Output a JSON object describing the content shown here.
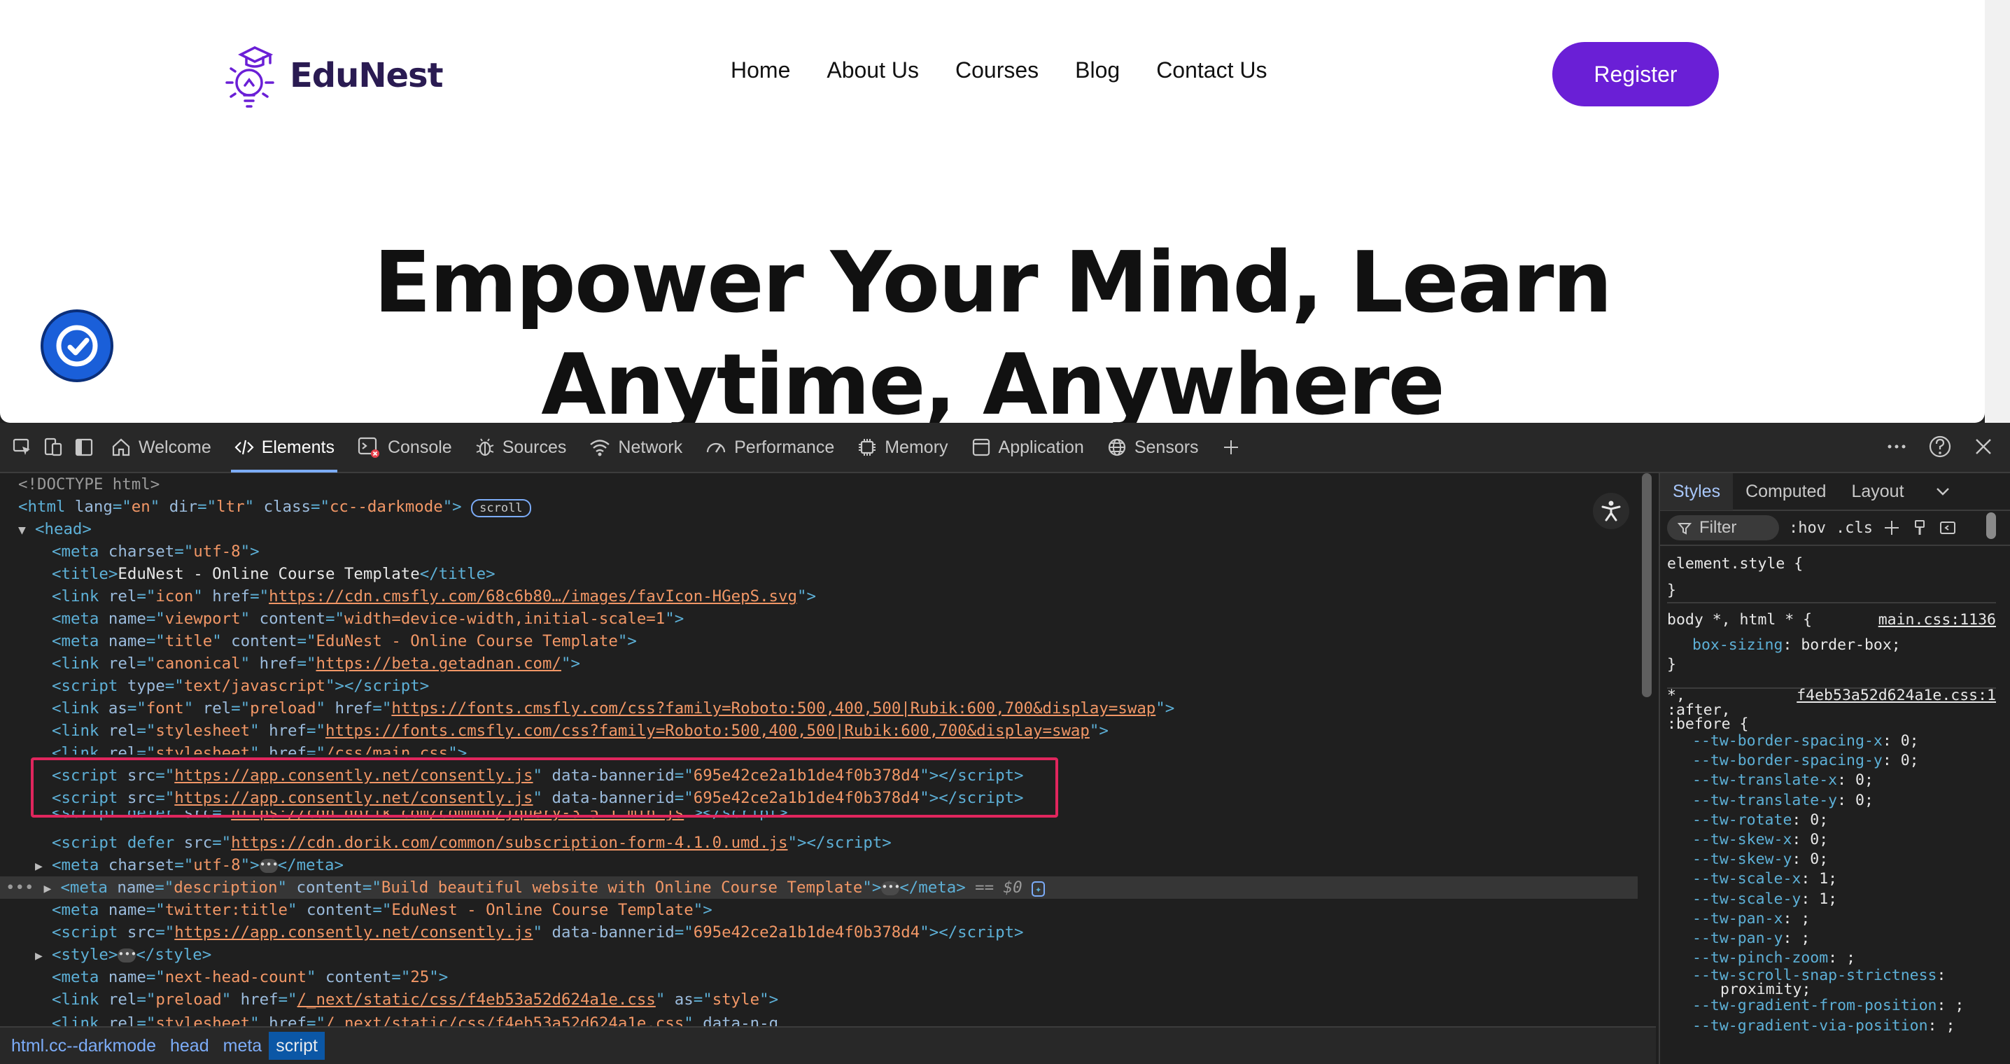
{
  "website": {
    "logo_text": "EduNest",
    "nav": [
      "Home",
      "About Us",
      "Courses",
      "Blog",
      "Contact Us"
    ],
    "register_label": "Register",
    "hero_line1": "Empower Your Mind, Learn",
    "hero_line2": "Anytime, Anywhere",
    "brand_color": "#6a1fd6"
  },
  "devtools": {
    "tabs": [
      "Welcome",
      "Elements",
      "Console",
      "Sources",
      "Network",
      "Performance",
      "Memory",
      "Application",
      "Sensors"
    ],
    "active_tab": "Elements",
    "dom": {
      "doctype": "<!DOCTYPE html>",
      "html_open": {
        "lang": "en",
        "dir": "ltr",
        "class": "cc--darkmode",
        "badge": "scroll"
      },
      "head": "head",
      "title_text": "EduNest - Online Course Template",
      "favicon_href": "https://cdn.cmsfly.com/68c6b80…/images/favIcon-HGepS.svg",
      "viewport_content": "width=device-width,initial-scale=1",
      "meta_title_content": "EduNest - Online Course Template",
      "canonical_href": "https://beta.getadnan.com/",
      "script_type": "text/javascript",
      "font_href": "https://fonts.cmsfly.com/css?family=Roboto:500,400,500|Rubik:600,700&display=swap",
      "stylesheet_href": "https://fonts.cmsfly.com/css?family=Roboto:500,400,500|Rubik:600,700&display=swap",
      "main_css_href": "/css/main.css",
      "consently_src": "https://app.consently.net/consently.js",
      "banner_id": "695e42ce2a1b1de4f0b378d4",
      "jquery_src": "https://cdn.dorik.com/common/jquery-3.5.1.min.js",
      "subscription_src": "https://cdn.dorik.com/common/subscription-form-4.1.0.umd.js",
      "meta_charset": "utf-8",
      "description_content": "Build beautiful website with Online Course Template",
      "dollar0": "== $0",
      "twitter_title_content": "EduNest - Online Course Template",
      "next_head_count": "25",
      "preload_href": "/_next/static/css/f4eb53a52d624a1e.css",
      "preload_as": "style",
      "stylesheet2_href": "/_next/static/css/f4eb53a52d624a1e.css",
      "data_n_g": "data-n-g"
    },
    "breadcrumbs": [
      "html.cc--darkmode",
      "head",
      "meta",
      "script"
    ],
    "active_breadcrumb": "script",
    "styles_tabs": [
      "Styles",
      "Computed",
      "Layout"
    ],
    "filter_placeholder": "Filter",
    "hov": ":hov",
    "cls": ".cls",
    "rules": {
      "element_style": "element.style {",
      "close": "}",
      "body_selector": "body *, html * {",
      "body_source": "main.css:1136",
      "box_sizing_name": "box-sizing",
      "box_sizing_value": "border-box;",
      "universal_selector_1": "*,",
      "universal_selector_2": ":after,",
      "universal_selector_3": ":before {",
      "universal_source": "f4eb53a52d624a1e.css:1",
      "props": [
        [
          "--tw-border-spacing-x",
          "0;"
        ],
        [
          "--tw-border-spacing-y",
          "0;"
        ],
        [
          "--tw-translate-x",
          "0;"
        ],
        [
          "--tw-translate-y",
          "0;"
        ],
        [
          "--tw-rotate",
          "0;"
        ],
        [
          "--tw-skew-x",
          "0;"
        ],
        [
          "--tw-skew-y",
          "0;"
        ],
        [
          "--tw-scale-x",
          "1;"
        ],
        [
          "--tw-scale-y",
          "1;"
        ],
        [
          "--tw-pan-x",
          ";"
        ],
        [
          "--tw-pan-y",
          ";"
        ],
        [
          "--tw-pinch-zoom",
          ";"
        ],
        [
          "--tw-scroll-snap-strictness",
          ""
        ],
        [
          "",
          "proximity;"
        ],
        [
          "--tw-gradient-from-position",
          ";"
        ],
        [
          "--tw-gradient-via-position",
          ";"
        ]
      ]
    }
  }
}
